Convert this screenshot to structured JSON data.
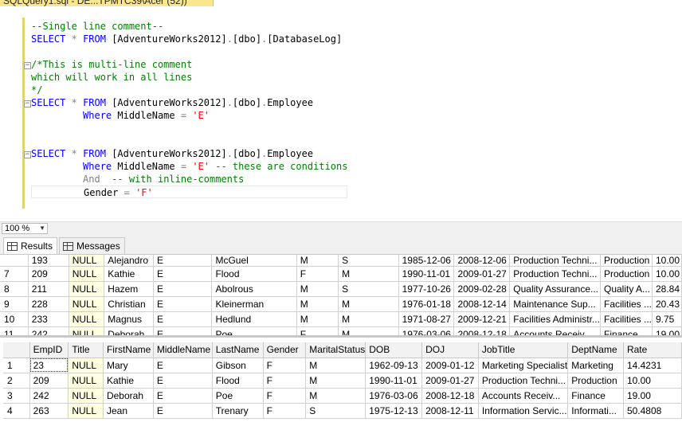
{
  "document_tab": {
    "title": "SQLQuery1.sql - DE...TPMTC39\\Acer (52))"
  },
  "editor": {
    "lines": [
      [
        {
          "t": "--Single line comment--",
          "c": "cm"
        }
      ],
      [
        {
          "t": "SELECT",
          "c": "kw"
        },
        {
          "t": " "
        },
        {
          "t": "*",
          "c": "op"
        },
        {
          "t": " "
        },
        {
          "t": "FROM",
          "c": "kw"
        },
        {
          "t": " [AdventureWorks2012]"
        },
        {
          "t": ".",
          "c": "op"
        },
        {
          "t": "[dbo]"
        },
        {
          "t": ".",
          "c": "op"
        },
        {
          "t": "[DatabaseLog]"
        }
      ],
      [],
      [
        {
          "t": "/*This is multi-line comment",
          "c": "cm"
        }
      ],
      [
        {
          "t": "which will work in all lines",
          "c": "cm"
        }
      ],
      [
        {
          "t": "*/",
          "c": "cm"
        }
      ],
      [
        {
          "t": "SELECT",
          "c": "kw"
        },
        {
          "t": " "
        },
        {
          "t": "*",
          "c": "op"
        },
        {
          "t": " "
        },
        {
          "t": "FROM",
          "c": "kw"
        },
        {
          "t": " [AdventureWorks2012]"
        },
        {
          "t": ".",
          "c": "op"
        },
        {
          "t": "[dbo]"
        },
        {
          "t": ".",
          "c": "op"
        },
        {
          "t": "Employee"
        }
      ],
      [
        {
          "t": "         "
        },
        {
          "t": "Where",
          "c": "kw"
        },
        {
          "t": " MiddleName "
        },
        {
          "t": "=",
          "c": "op"
        },
        {
          "t": " "
        },
        {
          "t": "'E'",
          "c": "str"
        }
      ],
      [],
      [],
      [
        {
          "t": "SELECT",
          "c": "kw"
        },
        {
          "t": " "
        },
        {
          "t": "*",
          "c": "op"
        },
        {
          "t": " "
        },
        {
          "t": "FROM",
          "c": "kw"
        },
        {
          "t": " [AdventureWorks2012]"
        },
        {
          "t": ".",
          "c": "op"
        },
        {
          "t": "[dbo]"
        },
        {
          "t": ".",
          "c": "op"
        },
        {
          "t": "Employee"
        }
      ],
      [
        {
          "t": "         "
        },
        {
          "t": "Where",
          "c": "kw"
        },
        {
          "t": " MiddleName "
        },
        {
          "t": "=",
          "c": "op"
        },
        {
          "t": " "
        },
        {
          "t": "'E'",
          "c": "str"
        },
        {
          "t": " "
        },
        {
          "t": "-- these are conditions",
          "c": "cm"
        }
      ],
      [
        {
          "t": "         "
        },
        {
          "t": "And",
          "c": "op"
        },
        {
          "t": "  "
        },
        {
          "t": "-- with inline-comments",
          "c": "cm"
        }
      ],
      [
        {
          "t": "         Gender "
        },
        {
          "t": "=",
          "c": "op"
        },
        {
          "t": " "
        },
        {
          "t": "'F'",
          "c": "str"
        }
      ]
    ]
  },
  "zoom": {
    "value": "100 %"
  },
  "tabs": {
    "results": "Results",
    "messages": "Messages"
  },
  "grid1": {
    "partial_row": [
      "",
      "193",
      "NULL",
      "Alejandro",
      "E",
      "McGuel",
      "M",
      "S",
      "1985-12-06",
      "2008-12-06",
      "Production Techni...",
      "Production",
      "10.00"
    ],
    "rows": [
      [
        "7",
        "209",
        "NULL",
        "Kathie",
        "E",
        "Flood",
        "F",
        "M",
        "1990-11-01",
        "2009-01-27",
        "Production Techni...",
        "Production",
        "10.00"
      ],
      [
        "8",
        "211",
        "NULL",
        "Hazem",
        "E",
        "Abolrous",
        "M",
        "S",
        "1977-10-26",
        "2009-02-28",
        "Quality Assurance...",
        "Quality A...",
        "28.84"
      ],
      [
        "9",
        "228",
        "NULL",
        "Christian",
        "E",
        "Kleinerman",
        "M",
        "M",
        "1976-01-18",
        "2008-12-14",
        "Maintenance Sup...",
        "Facilities ...",
        "20.43"
      ],
      [
        "10",
        "233",
        "NULL",
        "Magnus",
        "E",
        "Hedlund",
        "M",
        "M",
        "1971-08-27",
        "2009-12-21",
        "Facilities Administr...",
        "Facilities ...",
        "9.75"
      ],
      [
        "11",
        "242",
        "NULL",
        "Deborah",
        "E",
        "Poe",
        "F",
        "M",
        "1976-03-06",
        "2008-12-18",
        "Accounts Receiv...",
        "Finance",
        "19.00"
      ]
    ]
  },
  "grid2": {
    "columns": [
      "",
      "EmpID",
      "Title",
      "FirstName",
      "MiddleName",
      "LastName",
      "Gender",
      "MaritalStatus",
      "DOB",
      "DOJ",
      "JobTitle",
      "DeptName",
      "Rate"
    ],
    "rows": [
      [
        "1",
        "23",
        "NULL",
        "Mary",
        "E",
        "Gibson",
        "F",
        "M",
        "1962-09-13",
        "2009-01-12",
        "Marketing Specialist",
        "Marketing",
        "14.4231"
      ],
      [
        "2",
        "209",
        "NULL",
        "Kathie",
        "E",
        "Flood",
        "F",
        "M",
        "1990-11-01",
        "2009-01-27",
        "Production Techni...",
        "Production",
        "10.00"
      ],
      [
        "3",
        "242",
        "NULL",
        "Deborah",
        "E",
        "Poe",
        "F",
        "M",
        "1976-03-06",
        "2008-12-18",
        "Accounts Receiv...",
        "Finance",
        "19.00"
      ],
      [
        "4",
        "263",
        "NULL",
        "Jean",
        "E",
        "Trenary",
        "F",
        "S",
        "1975-12-13",
        "2008-12-11",
        "Information Servic...",
        "Informati...",
        "50.4808"
      ]
    ]
  }
}
